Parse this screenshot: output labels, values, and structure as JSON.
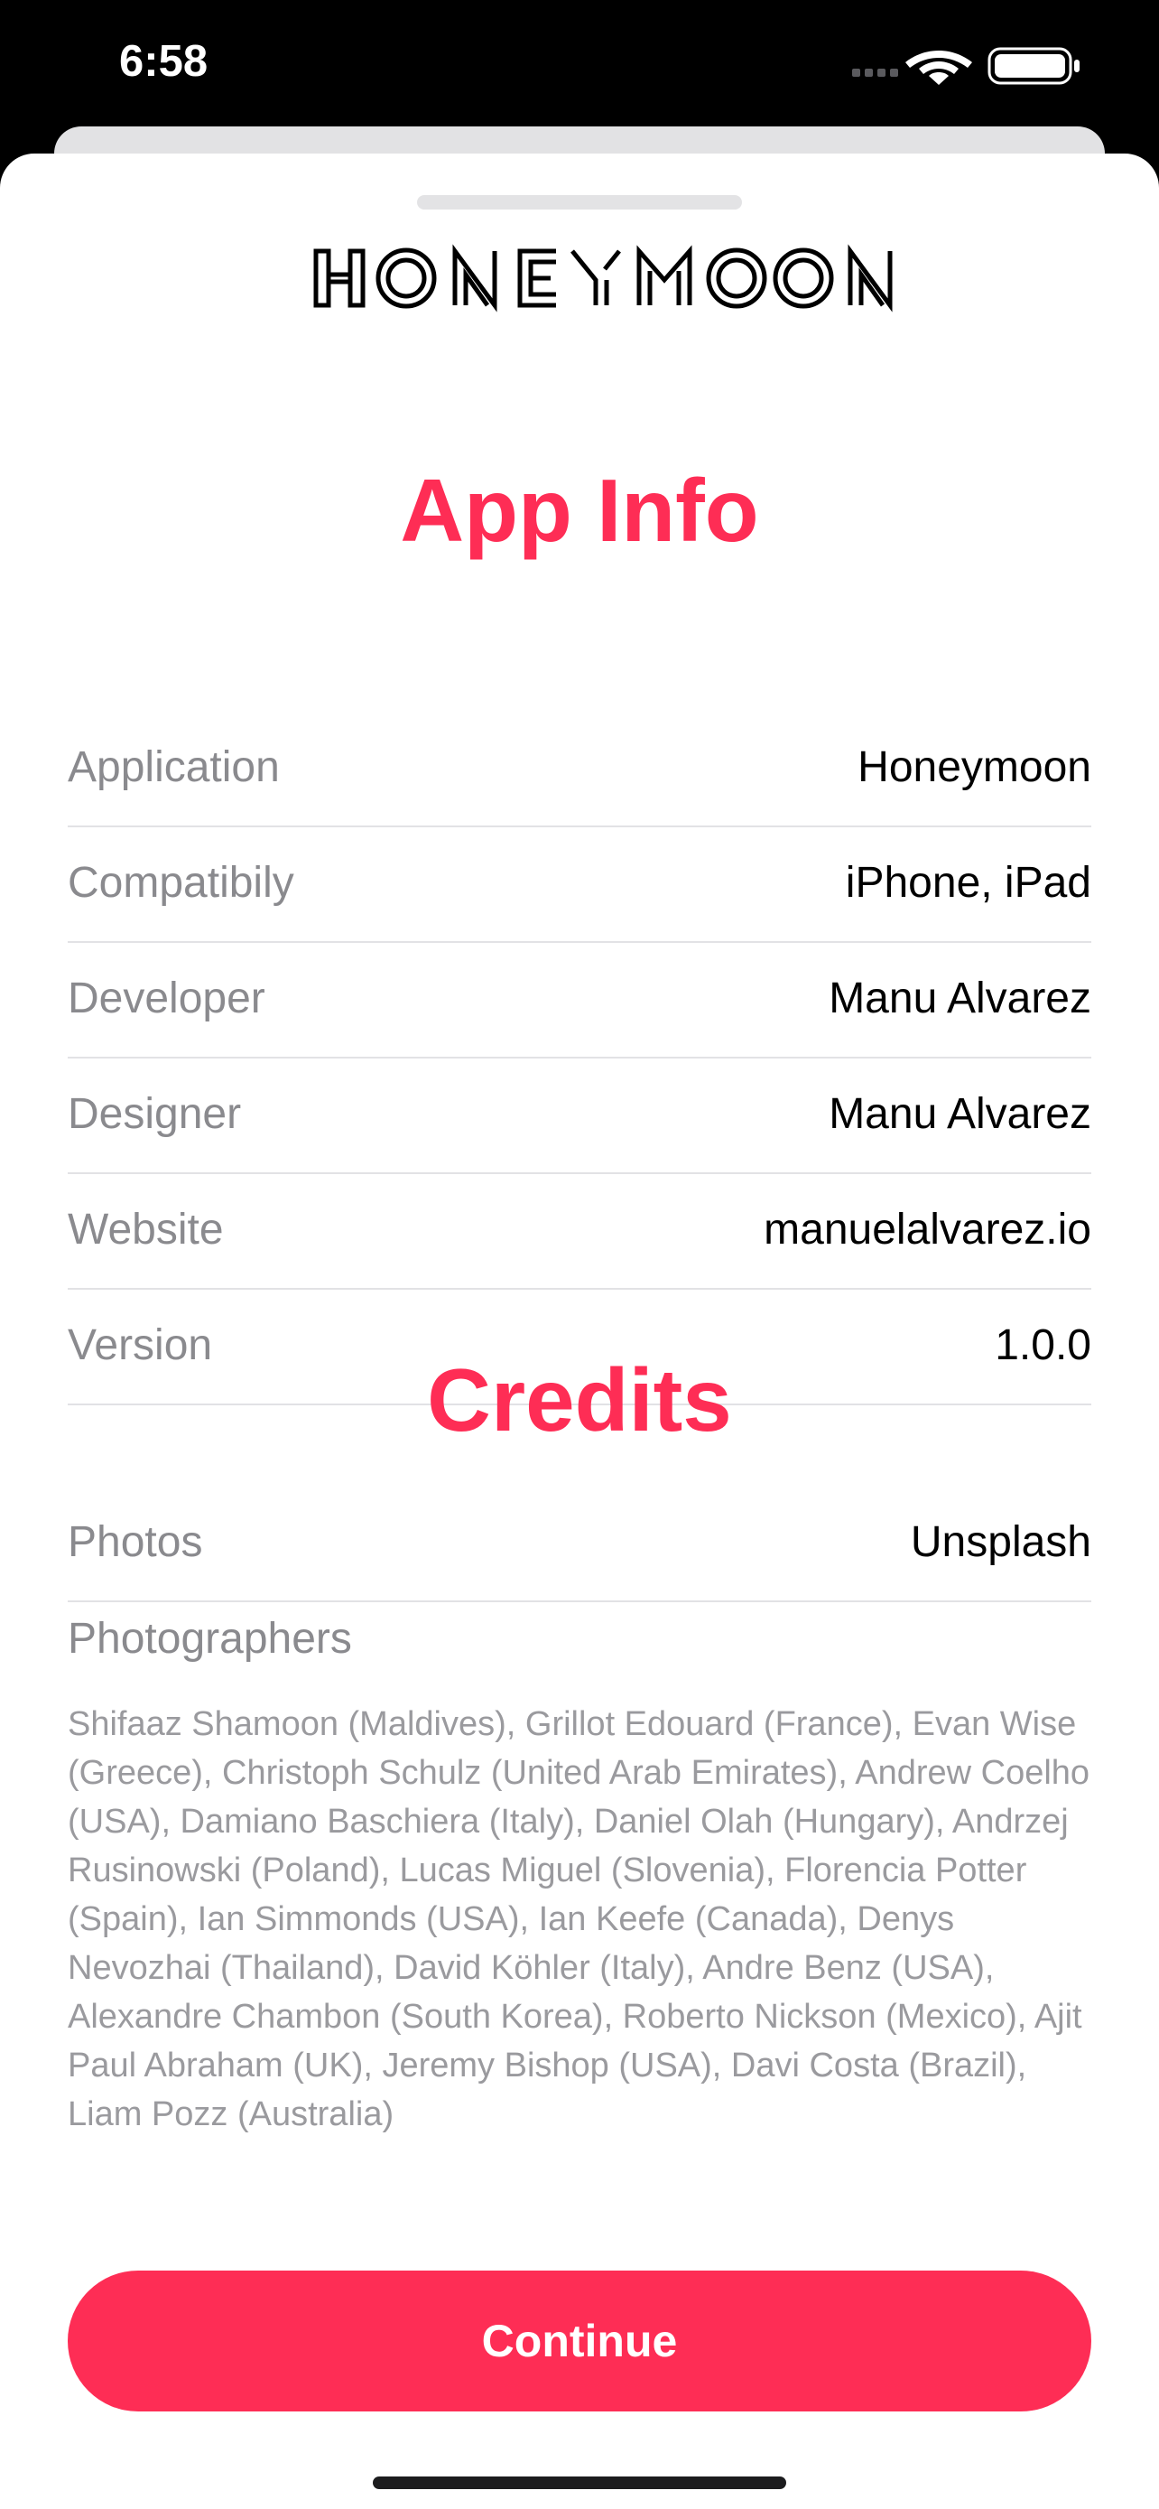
{
  "status_bar": {
    "time": "6:58",
    "icons": [
      "cellular-icon",
      "wifi-icon",
      "battery-icon"
    ]
  },
  "logo": {
    "text": "HONEYMOON"
  },
  "app_info": {
    "title": "App Info",
    "rows": [
      {
        "label": "Application",
        "value": "Honeymoon"
      },
      {
        "label": "Compatibily",
        "value": "iPhone, iPad"
      },
      {
        "label": "Developer",
        "value": "Manu Alvarez"
      },
      {
        "label": "Designer",
        "value": "Manu Alvarez"
      },
      {
        "label": "Website",
        "value": "manuelalvarez.io"
      },
      {
        "label": "Version",
        "value": "1.0.0"
      }
    ]
  },
  "credits": {
    "title": "Credits",
    "rows": [
      {
        "label": "Photos",
        "value": "Unsplash"
      }
    ],
    "photographers_label": "Photographers",
    "photographers_text": "Shifaaz Shamoon (Maldives), Grillot Edouard (France), Evan Wise (Greece), Christoph Schulz (United Arab Emirates), Andrew Coelho (USA), Damiano Baschiera (Italy), Daniel Olah (Hungary), Andrzej Rusinowski (Poland), Lucas Miguel (Slovenia), Florencia Potter (Spain), Ian Simmonds (USA), Ian Keefe (Canada), Denys Nevozhai (Thailand), David Köhler (Italy), Andre Benz (USA), Alexandre Chambon (South Korea), Roberto Nickson (Mexico), Ajit Paul Abraham (UK), Jeremy Bishop (USA), Davi Costa (Brazil), Liam Pozz (Australia)"
  },
  "continue_button": {
    "label": "Continue"
  },
  "colors": {
    "accent": "#fe2d55",
    "label_gray": "#8a8a8e",
    "separator": "#e2e2e5",
    "background": "#ffffff"
  }
}
